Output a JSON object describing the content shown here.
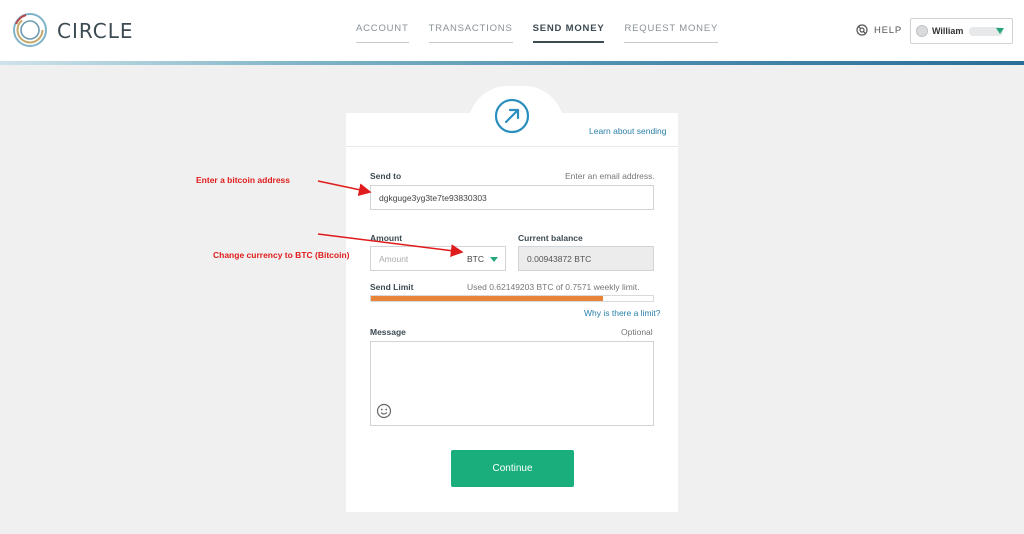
{
  "header": {
    "brand": "CIRCLE",
    "nav": [
      {
        "label": "ACCOUNT",
        "active": false
      },
      {
        "label": "TRANSACTIONS",
        "active": false
      },
      {
        "label": "SEND MONEY",
        "active": true
      },
      {
        "label": "REQUEST MONEY",
        "active": false
      }
    ],
    "help_label": "HELP",
    "user_name": "William"
  },
  "form": {
    "learn_link": "Learn about sending",
    "send_to_label": "Send to",
    "send_to_hint": "Enter an email address.",
    "send_to_value": "dgkguge3yg3te7te93830303",
    "amount_label": "Amount",
    "amount_placeholder": "Amount",
    "currency": "BTC",
    "balance_label": "Current balance",
    "balance_value": "0.00943872 BTC",
    "limit_label": "Send Limit",
    "limit_text": "Used 0.62149203 BTC of 0.7571 weekly limit.",
    "limit_fraction": 0.821,
    "why_link": "Why is there a limit?",
    "message_label": "Message",
    "message_hint": "Optional",
    "continue_label": "Continue"
  },
  "annotations": {
    "address_note": "Enter a bitcoin address",
    "currency_note": "Change currency to BTC (Bitcoin)"
  },
  "colors": {
    "accent_green": "#1aae7c",
    "limit_orange": "#e8843a",
    "link_blue": "#2a7fa8",
    "annotation_red": "#e01b1b"
  },
  "icons": {
    "logo": "circle-logo-icon",
    "help": "help-lifebuoy-icon",
    "send": "send-arrow-icon",
    "emoji": "smiley-icon",
    "dropdown": "chevron-down-icon"
  }
}
